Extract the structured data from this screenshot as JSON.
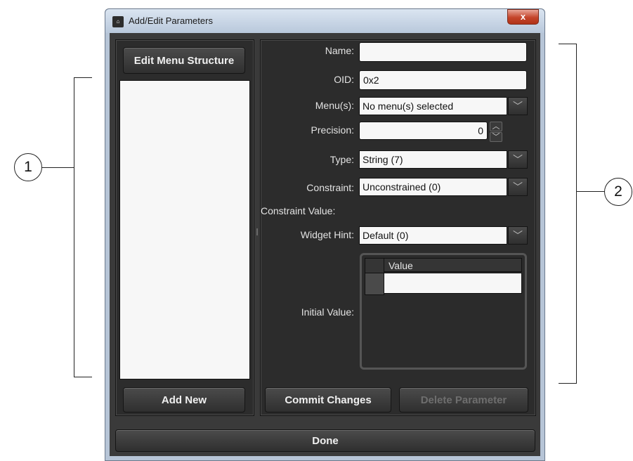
{
  "window": {
    "title": "Add/Edit Parameters",
    "close_label": "x",
    "app_icon": "app-icon"
  },
  "callouts": {
    "left": "1",
    "right": "2"
  },
  "left_panel": {
    "edit_menu_button": "Edit Menu Structure",
    "add_new_button": "Add New"
  },
  "form": {
    "name_label": "Name:",
    "name_value": "",
    "oid_label": "OID:",
    "oid_value": "0x2",
    "menus_label": "Menu(s):",
    "menus_value": "No menu(s) selected",
    "precision_label": "Precision:",
    "precision_value": "0",
    "type_label": "Type:",
    "type_value": "String (7)",
    "constraint_label": "Constraint:",
    "constraint_value": "Unconstrained (0)",
    "constraint_value_label": "Constraint Value:",
    "widget_hint_label": "Widget Hint:",
    "widget_hint_value": "Default (0)",
    "initial_value_label": "Initial Value:",
    "initial_value_table": {
      "column_header": "Value",
      "rows": [
        ""
      ]
    }
  },
  "actions": {
    "commit": "Commit Changes",
    "delete": "Delete Parameter",
    "done": "Done"
  },
  "icons": {
    "dropdown": "chevron-down-icon",
    "spin_up": "chevron-up-icon",
    "spin_down": "chevron-down-icon"
  }
}
